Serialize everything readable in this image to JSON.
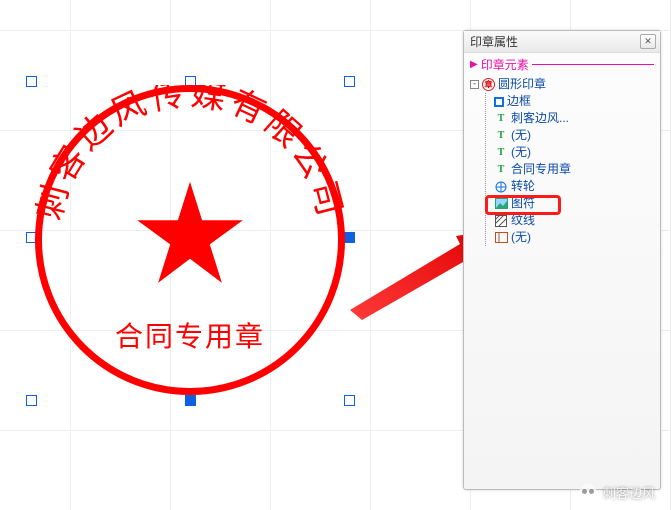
{
  "panel": {
    "title": "印章属性",
    "section": "印章元素",
    "close_hint": "✕"
  },
  "tree": {
    "root": {
      "label": "圆形印章"
    },
    "items": [
      {
        "label": "边框",
        "icon": "border"
      },
      {
        "label": "刺客边风...",
        "icon": "text"
      },
      {
        "label": "(无)",
        "icon": "text"
      },
      {
        "label": "(无)",
        "icon": "text"
      },
      {
        "label": "合同专用章",
        "icon": "text"
      },
      {
        "label": "转轮",
        "icon": "wheel"
      },
      {
        "label": "图符",
        "icon": "img"
      },
      {
        "label": "纹线",
        "icon": "hatch"
      },
      {
        "label": "(无)",
        "icon": "frame"
      }
    ]
  },
  "seal": {
    "arc_text": "刺客边风传媒有限公司",
    "bottom_text": "合同专用章"
  },
  "watermark": {
    "text": "刺客边风"
  },
  "colors": {
    "seal": "#ff0000",
    "link": "#0a4aa8",
    "pink": "#e80fa4"
  }
}
